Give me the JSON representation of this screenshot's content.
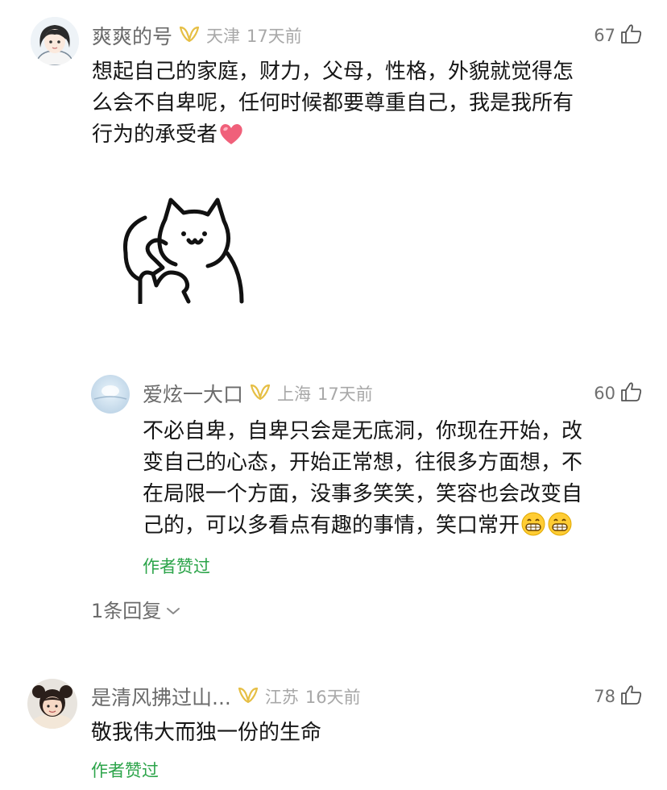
{
  "comments": [
    {
      "username": "爽爽的号",
      "location": "天津",
      "time": "17天前",
      "likes": "67",
      "text": [
        "想起自己的家庭，财力，父母，性格，外貌就觉得怎",
        "么会不自卑呢，任何时候都要尊重自己，我是我所有",
        "行为的承受者"
      ],
      "emoji": "heart-emoji",
      "sticker": "cat-thumbs-up-sticker"
    },
    {
      "username": "爱炫一大口",
      "location": "上海",
      "time": "17天前",
      "likes": "60",
      "text": [
        "不必自卑，自卑只会是无底洞，你现在开始，改",
        "变自己的心态，开始正常想，往很多方面想，不",
        "在局限一个方面，没事多笑笑，笑容也会改变自",
        "己的，可以多看点有趣的事情，笑口常开"
      ],
      "emoji": "grin-emoji",
      "author_liked": "作者赞过",
      "replies": "1条回复"
    },
    {
      "username": "是清风拂过山...",
      "location": "江苏",
      "time": "16天前",
      "likes": "78",
      "text": [
        "敬我伟大而独一份的生命"
      ],
      "author_liked": "作者赞过"
    }
  ],
  "colors": {
    "name": "#6b6b6b",
    "meta": "#a8a8a8",
    "badge": "#e6bf45",
    "author_liked": "#2ca44a",
    "heart": "#f0607a"
  }
}
